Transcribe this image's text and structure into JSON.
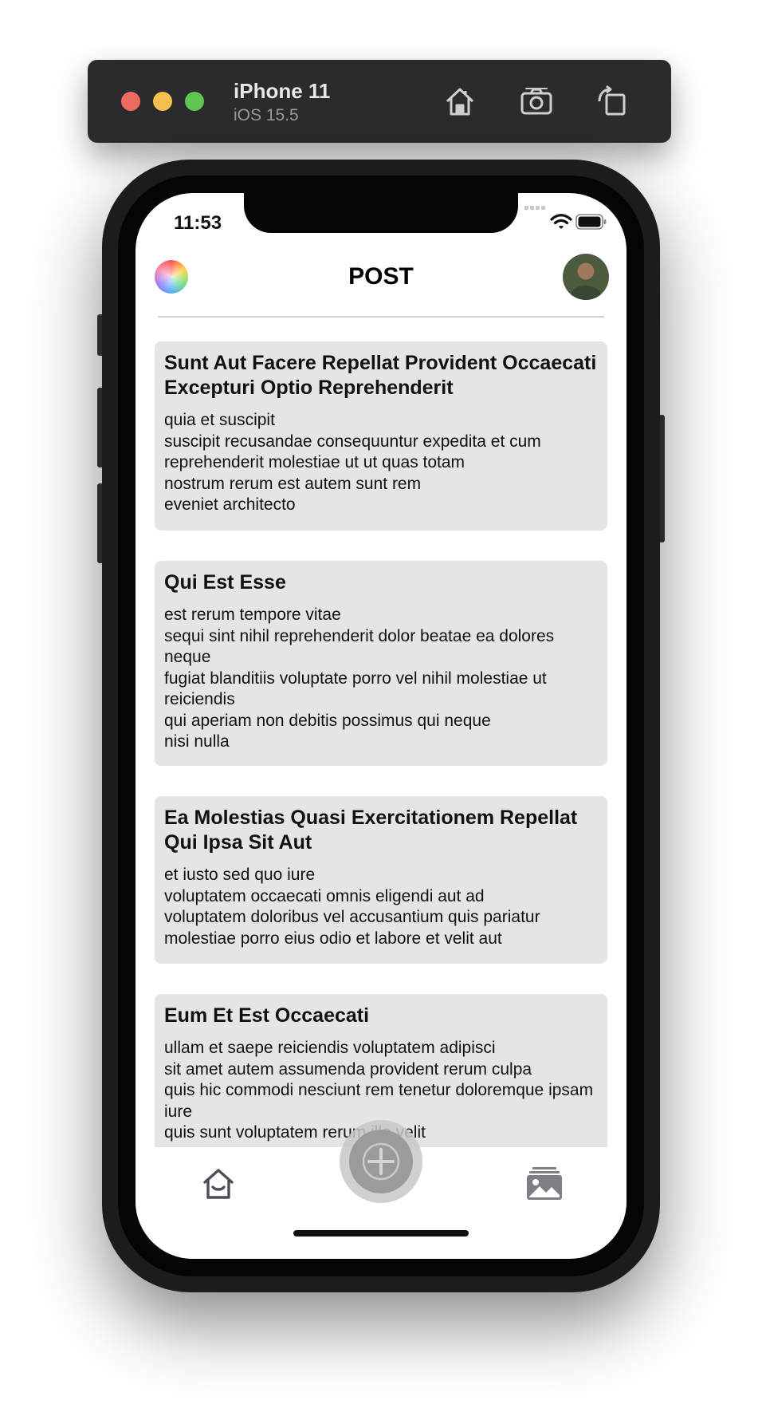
{
  "simulator": {
    "device_name": "iPhone 11",
    "os_version": "iOS 15.5",
    "icons": [
      "home-icon",
      "camera-icon",
      "rotate-icon"
    ]
  },
  "status_bar": {
    "time": "11:53",
    "icons": [
      "cellular-signal-icon",
      "wifi-icon",
      "battery-icon"
    ]
  },
  "header": {
    "title": "POST",
    "left_icon": "color-wheel-icon",
    "right_icon": "avatar"
  },
  "posts": [
    {
      "title": "Sunt Aut Facere Repellat Provident Occaecati Excepturi Optio Reprehenderit",
      "body": "quia et suscipit\nsuscipit recusandae consequuntur expedita et cum reprehenderit molestiae ut ut quas totam\nnostrum rerum est autem sunt rem\neveniet architecto"
    },
    {
      "title": "Qui Est Esse",
      "body": "est rerum tempore vitae\nsequi sint nihil reprehenderit dolor beatae ea dolores neque\nfugiat blanditiis voluptate porro vel nihil molestiae ut reiciendis\nqui aperiam non debitis possimus qui neque\nnisi nulla"
    },
    {
      "title": "Ea Molestias Quasi Exercitationem Repellat Qui Ipsa Sit Aut",
      "body": "et iusto sed quo iure\nvoluptatem occaecati omnis eligendi aut ad\nvoluptatem doloribus vel accusantium quis pariatur\nmolestiae porro eius odio et labore et velit aut"
    },
    {
      "title": "Eum Et Est Occaecati",
      "body": "ullam et saepe reiciendis voluptatem adipisci\nsit amet autem assumenda provident rerum culpa\nquis hic commodi nesciunt rem tenetur doloremque ipsam iure\nquis sunt voluptatem rerum illo velit"
    }
  ],
  "tab_bar": {
    "items": [
      "home-icon",
      "add-icon",
      "gallery-icon"
    ]
  },
  "colors": {
    "card_background": "#e5e5e5",
    "fab": "#9b9b9b",
    "tab_icon": "#4a4f57"
  }
}
